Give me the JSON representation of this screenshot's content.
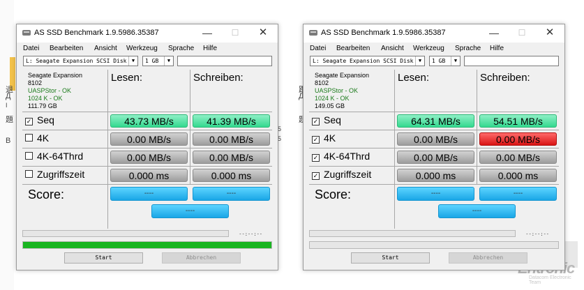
{
  "background": {
    "side_chars": [
      "退",
      "Д",
      "題",
      "I",
      "B"
    ],
    "mid_chars": [
      "跟",
      "Д",
      "題",
      "5",
      "5"
    ],
    "watermark_main": "Entronic",
    "watermark_sub": "Datacom Electronic Team"
  },
  "windows": [
    {
      "title": "AS SSD Benchmark 1.9.5986.35387",
      "menu": [
        "Datei",
        "Bearbeiten",
        "Ansicht",
        "Werkzeug",
        "Sprache",
        "Hilfe"
      ],
      "drive_select": "L: Seagate Expansion SCSI Disk De",
      "size_select": "1 GB",
      "info": {
        "name": "Seagate Expansion",
        "id": "8102",
        "driver": "UASPStor - OK",
        "align": "1024 K - OK",
        "capacity": "111.79 GB"
      },
      "col_read": "Lesen:",
      "col_write": "Schreiben:",
      "rows": [
        {
          "label": "Seq",
          "checked": true,
          "read": "43.73 MB/s",
          "write": "41.39 MB/s",
          "read_color": "green",
          "write_color": "green"
        },
        {
          "label": "4K",
          "checked": false,
          "read": "0.00 MB/s",
          "write": "0.00 MB/s",
          "read_color": "gray",
          "write_color": "gray"
        },
        {
          "label": "4K-64Thrd",
          "checked": false,
          "read": "0.00 MB/s",
          "write": "0.00 MB/s",
          "read_color": "gray",
          "write_color": "gray"
        },
        {
          "label": "Zugriffszeit",
          "checked": false,
          "read": "0.000 ms",
          "write": "0.000 ms",
          "read_color": "gray",
          "write_color": "gray"
        }
      ],
      "score_label": "Score:",
      "score_read": "----",
      "score_write": "----",
      "score_total": "----",
      "progress_time": "--:--:--",
      "total_progress": 1.0,
      "start_label": "Start",
      "abort_label": "Abbrechen"
    },
    {
      "title": "AS SSD Benchmark 1.9.5986.35387",
      "menu": [
        "Datei",
        "Bearbeiten",
        "Ansicht",
        "Werkzeug",
        "Sprache",
        "Hilfe"
      ],
      "drive_select": "L: Seagate Expansion SCSI Disk De",
      "size_select": "1 GB",
      "info": {
        "name": "Seagate Expansion",
        "id": "8102",
        "driver": "UASPStor - OK",
        "align": "1024 K - OK",
        "capacity": "149.05 GB"
      },
      "col_read": "Lesen:",
      "col_write": "Schreiben:",
      "rows": [
        {
          "label": "Seq",
          "checked": true,
          "read": "64.31 MB/s",
          "write": "54.51 MB/s",
          "read_color": "green",
          "write_color": "green"
        },
        {
          "label": "4K",
          "checked": true,
          "read": "0.00 MB/s",
          "write": "0.00 MB/s",
          "read_color": "gray",
          "write_color": "red"
        },
        {
          "label": "4K-64Thrd",
          "checked": true,
          "read": "0.00 MB/s",
          "write": "0.00 MB/s",
          "read_color": "gray",
          "write_color": "gray"
        },
        {
          "label": "Zugriffszeit",
          "checked": true,
          "read": "0.000 ms",
          "write": "0.000 ms",
          "read_color": "gray",
          "write_color": "gray"
        }
      ],
      "score_label": "Score:",
      "score_read": "----",
      "score_write": "----",
      "score_total": "----",
      "progress_time": "--:--:--",
      "total_progress": 0.0,
      "start_label": "Start",
      "abort_label": "Abbrechen"
    }
  ]
}
